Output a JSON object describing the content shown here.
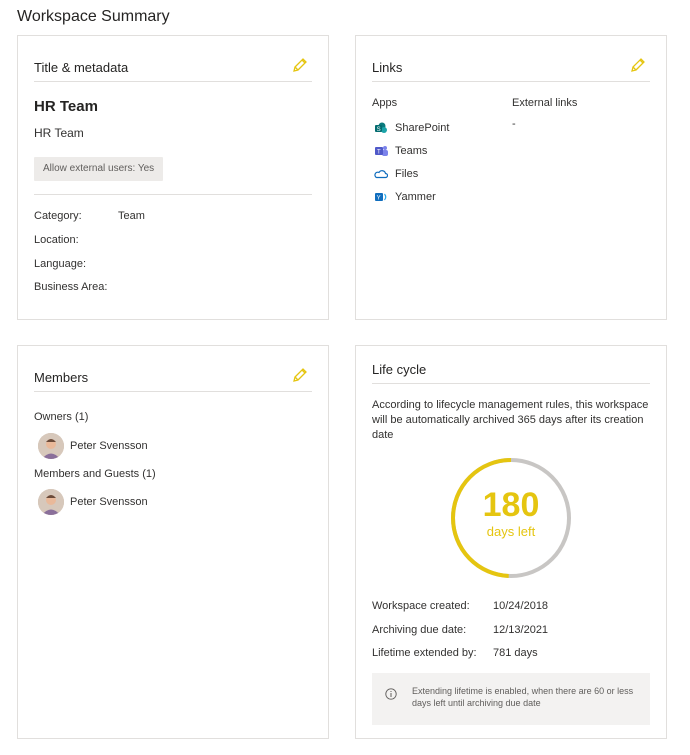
{
  "page": {
    "title": "Workspace Summary"
  },
  "title_card": {
    "heading": "Title & metadata",
    "team_name": "HR Team",
    "team_subtitle": "HR Team",
    "external_badge": "Allow external users: Yes",
    "fields": {
      "category_label": "Category:",
      "category_value": "Team",
      "location_label": "Location:",
      "location_value": "",
      "language_label": "Language:",
      "language_value": "",
      "business_area_label": "Business Area:",
      "business_area_value": ""
    }
  },
  "links_card": {
    "heading": "Links",
    "apps_label": "Apps",
    "external_label": "External links",
    "external_value": "-",
    "apps": [
      {
        "label": "SharePoint",
        "icon": "sharepoint-icon",
        "color": "#038387"
      },
      {
        "label": "Teams",
        "icon": "teams-icon",
        "color": "#6264a7"
      },
      {
        "label": "Files",
        "icon": "onedrive-icon",
        "color": "#0f6cbd"
      },
      {
        "label": "Yammer",
        "icon": "yammer-icon",
        "color": "#106ebe"
      }
    ]
  },
  "members_card": {
    "heading": "Members",
    "owners_label": "Owners (1)",
    "owners": [
      {
        "name": "Peter Svensson"
      }
    ],
    "members_label": "Members and Guests (1)",
    "members": [
      {
        "name": "Peter Svensson"
      }
    ]
  },
  "lifecycle_card": {
    "heading": "Life cycle",
    "description": "According to lifecycle management rules, this workspace will be automatically archived 365 days after its creation date",
    "days_left_value": "180",
    "days_left_label": "days left",
    "remaining_fraction": 0.493,
    "created_label": "Workspace created:",
    "created_value": "10/24/2018",
    "due_label": "Archiving due date:",
    "due_value": "12/13/2021",
    "extended_label": "Lifetime extended by:",
    "extended_value": "781 days",
    "info_text": "Extending lifetime is enabled, when there are 60 or less days left until archiving due date"
  },
  "colors": {
    "accent": "#e5c510",
    "ring_track": "#c8c6c4",
    "border": "#e1dfdd"
  }
}
